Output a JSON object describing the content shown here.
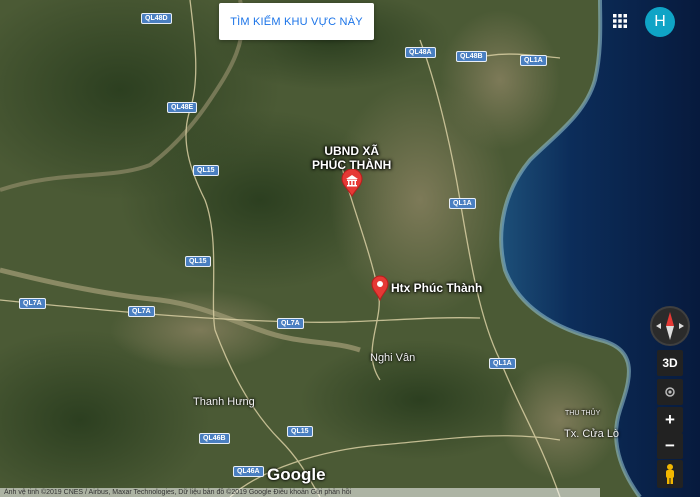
{
  "search_area_button": {
    "label": "TÌM KIẾM KHU VỰC NÀY"
  },
  "account": {
    "avatar_letter": "H"
  },
  "apps_icon": "grid-apps-icon",
  "road_labels": [
    "QL48D",
    "QL48A",
    "QL48B",
    "QL1A",
    "QL48E",
    "QL15",
    "QL1A",
    "QL15",
    "QL7A",
    "QL7A",
    "QL7A",
    "QL1A",
    "QL46B",
    "QL15",
    "QL46A"
  ],
  "place_labels": [
    "Nghi Vân",
    "Thanh Hưng",
    "THU THỦY",
    "Tx. Cửa Lò"
  ],
  "poi": {
    "ubnd": {
      "line1": "UBND XÃ",
      "line2": "PHÚC THÀNH",
      "icon": "government-building-icon"
    },
    "htx": {
      "label": "Htx Phúc Thành",
      "icon": "map-pin-icon"
    }
  },
  "branding": {
    "logo_text": "Google"
  },
  "controls": {
    "view_3d": "3D",
    "zoom_in": "+",
    "zoom_out": "−"
  },
  "attribution": "Ảnh vệ tinh ©2019 CNES / Airbus, Maxar Technologies, Dữ liệu bản đồ ©2019 Google   Điều khoản   Gửi phản hồi",
  "colors": {
    "pin_red": "#e53935",
    "road_shield": "#4a7fc1",
    "avatar_bg": "#0fa4c6",
    "sea": "#0b2a55"
  }
}
